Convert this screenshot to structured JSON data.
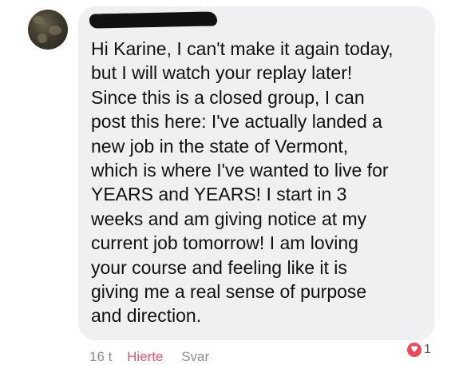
{
  "comment": {
    "author": "",
    "text_lines": [
      "Hi Karine, I can't make it again today,",
      "but I will watch your replay later!",
      "Since this is a closed group, I can",
      "post this here:  I've actually landed a",
      "new job in the state of Vermont,",
      "which is where I've wanted to live for",
      "YEARS and YEARS!  I start in 3",
      "weeks and am giving notice at my",
      "current job tomorrow!  I am loving",
      "your course and feeling like it is",
      "giving me a real sense of purpose",
      "and direction."
    ],
    "timestamp": "16 t",
    "like_label": "Hierte",
    "reply_label": "Svar",
    "reaction_count": "1",
    "reaction_icon": "heart-icon"
  },
  "colors": {
    "bubble_background": "#f0f0f2",
    "text": "#111111",
    "meta_text": "#8a8d91",
    "like_active": "#e4546a",
    "heart_reaction": "#f0475b"
  }
}
